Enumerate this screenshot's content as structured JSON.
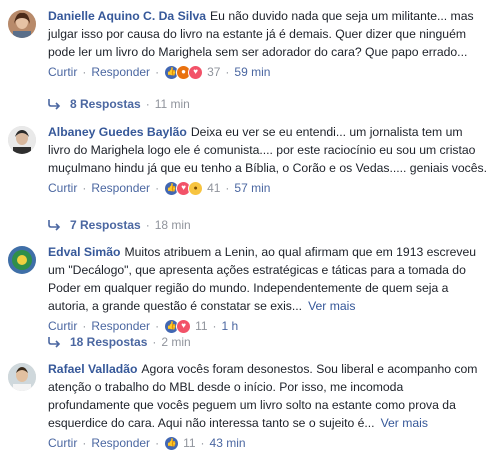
{
  "comments": [
    {
      "author": "Danielle Aquino C. Da Silva",
      "text": "Eu não duvido nada que seja um militante... mas julgar isso por causa do livro na estante já é demais. Quer dizer que ninguém pode ler um livro do Marighela sem ser adorador do cara? Que papo errado...",
      "like_label": "Curtir",
      "reply_label": "Responder",
      "reaction_icons": [
        "like",
        "angry",
        "love"
      ],
      "reaction_count": "37",
      "time": "59 min",
      "replies_label": "8 Respostas",
      "replies_time": "11 min"
    },
    {
      "author": "Albaney Guedes Baylão",
      "text": "Deixa eu ver se eu entendi... um jornalista tem um livro do Marighela logo ele é comunista.... por este raciocínio eu sou um cristao muçulmano hindu já que eu tenho a Bíblia, o Corão e os Vedas..... geniais vocês.",
      "like_label": "Curtir",
      "reply_label": "Responder",
      "reaction_icons": [
        "like",
        "love",
        "haha"
      ],
      "reaction_count": "41",
      "time": "57 min",
      "replies_label": "7 Respostas",
      "replies_time": "18 min"
    },
    {
      "author": "Edval Simão",
      "text": "Muitos atribuem a Lenin, ao qual afirmam que em 1913 escreveu um \"Decálogo\", que apresenta ações estratégicas e táticas para a tomada do Poder em qualquer região do mundo. Independentemente de quem seja a autoria, a grande questão é constatar se exis...",
      "more_label": "Ver mais",
      "like_label": "Curtir",
      "reply_label": "Responder",
      "reaction_icons": [
        "like",
        "love"
      ],
      "reaction_count": "11",
      "time": "1 h",
      "replies_label": "18 Respostas",
      "replies_time": "2 min"
    },
    {
      "author": "Rafael Valladão",
      "text": "Agora vocês foram desonestos. Sou liberal e acompanho com atenção o trabalho do MBL desde o início. Por isso, me incomoda profundamente que vocês peguem um livro solto na estante como prova da esquerdice do cara. Aqui não interessa tanto se o sujeito é...",
      "more_label": "Ver mais",
      "like_label": "Curtir",
      "reply_label": "Responder",
      "reaction_icons": [
        "like"
      ],
      "reaction_count": "11",
      "time": "43 min"
    }
  ],
  "separator": "·",
  "colors": {
    "link": "#365899",
    "meta": "#90949c",
    "like": "#4267b2",
    "love": "#f25268",
    "angry": "#e9710f",
    "haha": "#f7c440"
  }
}
